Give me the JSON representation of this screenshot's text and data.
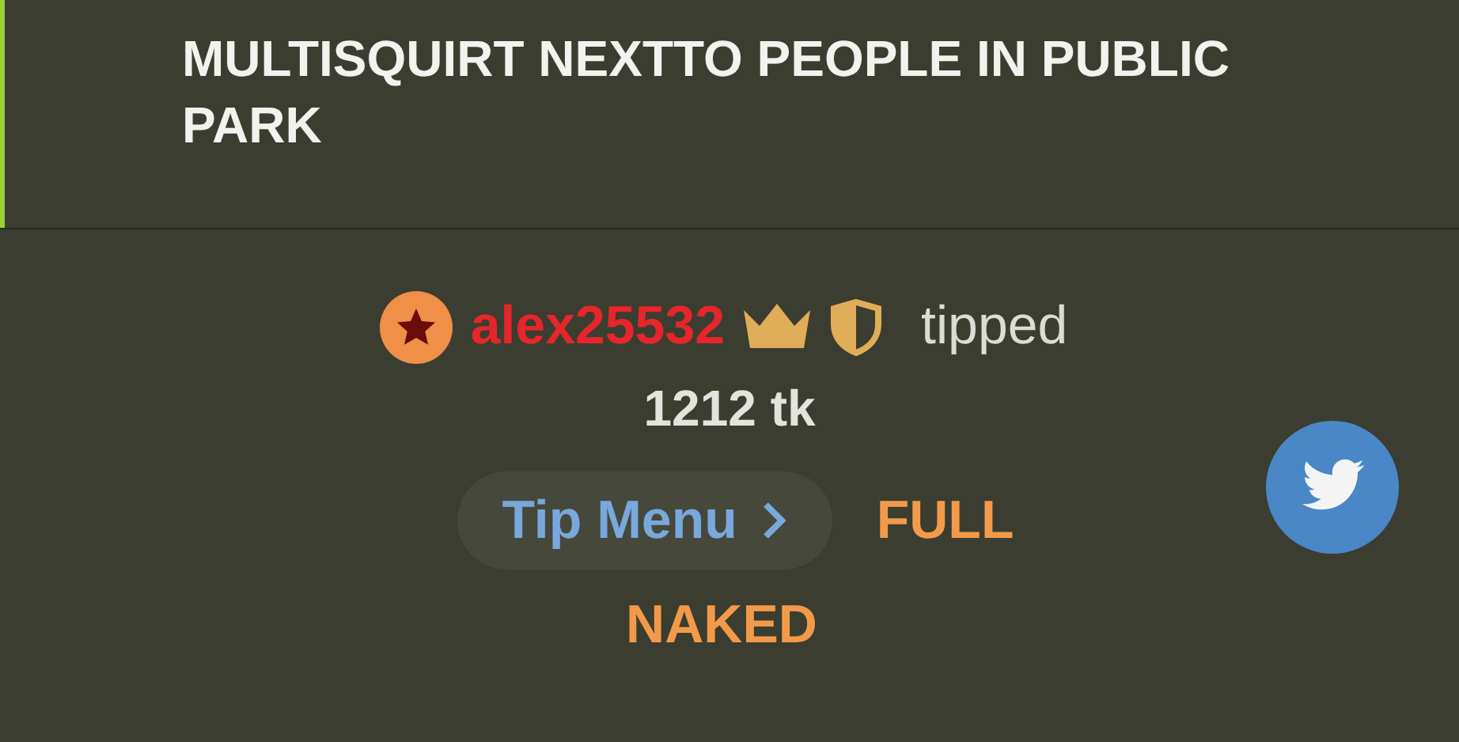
{
  "title": "MULTISQUIRT NEXTTO PEOPLE IN PUBLIC PARK",
  "tip": {
    "username": "alex25532",
    "action": "tipped",
    "amount": "1212 tk"
  },
  "tip_menu_button": {
    "label": "Tip Menu"
  },
  "tip_item_lines": [
    "FULL",
    "NAKED"
  ]
}
